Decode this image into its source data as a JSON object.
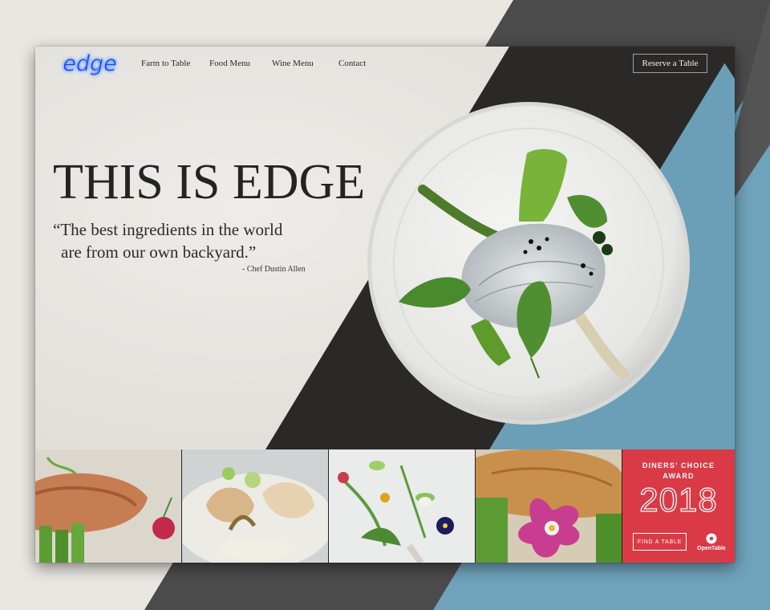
{
  "brand": {
    "logo_text": "edge"
  },
  "nav": {
    "items": [
      {
        "label": "Farm to Table"
      },
      {
        "label": "Food Menu"
      },
      {
        "label": "Wine Menu"
      },
      {
        "label": "Contact"
      }
    ],
    "cta_label": "Reserve a Table"
  },
  "hero": {
    "headline": "THIS IS EDGE",
    "quote_line1": "“The best ingredients in the world",
    "quote_line2": "are from our own backyard.”",
    "attribution": "- Chef Dustin Allen"
  },
  "gallery": {
    "images": [
      {
        "icon": "salmon-asparagus-dish"
      },
      {
        "icon": "scallop-dish"
      },
      {
        "icon": "microgreens-dish"
      },
      {
        "icon": "chicken-orchid-dish"
      }
    ]
  },
  "award": {
    "title_line1": "DINERS’ CHOICE",
    "title_line2": "AWARD",
    "year": "2018",
    "button_label": "FIND A TABLE",
    "partner": "OpenTable",
    "color": "#d93a46"
  },
  "colors": {
    "dark_band": "#2b2a29",
    "blue_band": "#6a9fb7",
    "accent_red": "#d93a46",
    "logo_blue": "#2f6bff"
  }
}
